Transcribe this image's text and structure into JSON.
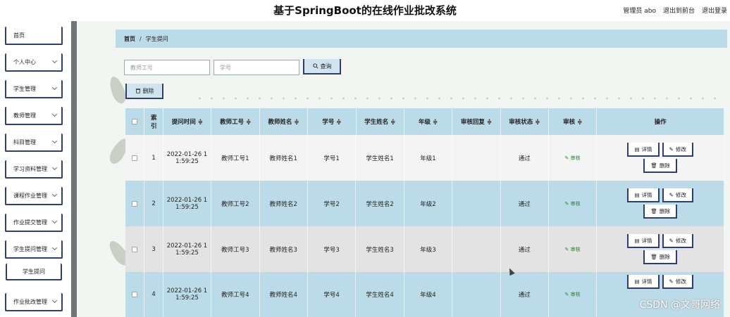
{
  "header": {
    "title": "基于SpringBoot的在线作业批改系统",
    "user": "管理员 abo",
    "to_frontend": "退出到前台",
    "logout": "退出登录"
  },
  "sidebar": {
    "items": [
      {
        "label": "首页",
        "has_chevron": false
      },
      {
        "label": "个人中心",
        "has_chevron": true
      },
      {
        "label": "学生管理",
        "has_chevron": true
      },
      {
        "label": "教师管理",
        "has_chevron": true
      },
      {
        "label": "科目管理",
        "has_chevron": true
      },
      {
        "label": "学习资料管理",
        "has_chevron": true
      },
      {
        "label": "课程作业管理",
        "has_chevron": true
      },
      {
        "label": "作业提交管理",
        "has_chevron": true
      },
      {
        "label": "学生提问管理",
        "has_chevron": true
      },
      {
        "label": "学生提问",
        "has_chevron": false
      },
      {
        "label": "作业批改管理",
        "has_chevron": true
      }
    ]
  },
  "breadcrumb": {
    "home": "首页",
    "sep": "/",
    "current": "学生提问"
  },
  "search": {
    "teacher_placeholder": "教师工号",
    "student_placeholder": "学号",
    "button": "查询",
    "search_icon": "search-icon"
  },
  "toolbar": {
    "delete_label": "删除",
    "trash_icon": "trash-icon"
  },
  "table": {
    "headers": [
      "索引",
      "提问时间 ≑",
      "教师工号 ≑",
      "教师姓名 ≑",
      "学号 ≑",
      "学生姓名 ≑",
      "年级 ≑",
      "审核回复 ≑",
      "审核状态 ≑",
      "审核 ≑",
      "操作"
    ],
    "rows": [
      {
        "index": "1",
        "time": "2022-01-26 1 1:59:25",
        "teacher_id": "教师工号1",
        "teacher_name": "教师姓名1",
        "student_id": "学号1",
        "student_name": "学生姓名1",
        "grade": "年级1",
        "reply": "",
        "status": "通过",
        "audit": "审核"
      },
      {
        "index": "2",
        "time": "2022-01-26 1 1:59:25",
        "teacher_id": "教师工号2",
        "teacher_name": "教师姓名2",
        "student_id": "学号2",
        "student_name": "学生姓名2",
        "grade": "年级2",
        "reply": "",
        "status": "通过",
        "audit": "审核"
      },
      {
        "index": "3",
        "time": "2022-01-26 1 1:59:25",
        "teacher_id": "教师工号3",
        "teacher_name": "教师姓名3",
        "student_id": "学号3",
        "student_name": "学生姓名3",
        "grade": "年级3",
        "reply": "",
        "status": "通过",
        "audit": "审核"
      },
      {
        "index": "4",
        "time": "2022-01-26 1 1:59:25",
        "teacher_id": "教师工号4",
        "teacher_name": "教师姓名4",
        "student_id": "学号4",
        "student_name": "学生姓名4",
        "grade": "年级4",
        "reply": "",
        "status": "通过",
        "audit": "审核"
      }
    ],
    "actions": {
      "detail": "详情",
      "edit": "修改",
      "delete": "删除"
    }
  },
  "watermark": "CSDN @文哥网络",
  "colors": {
    "accent": "#bcdbe8",
    "border": "#2f3e6b",
    "audit_link": "#2e7d32"
  }
}
